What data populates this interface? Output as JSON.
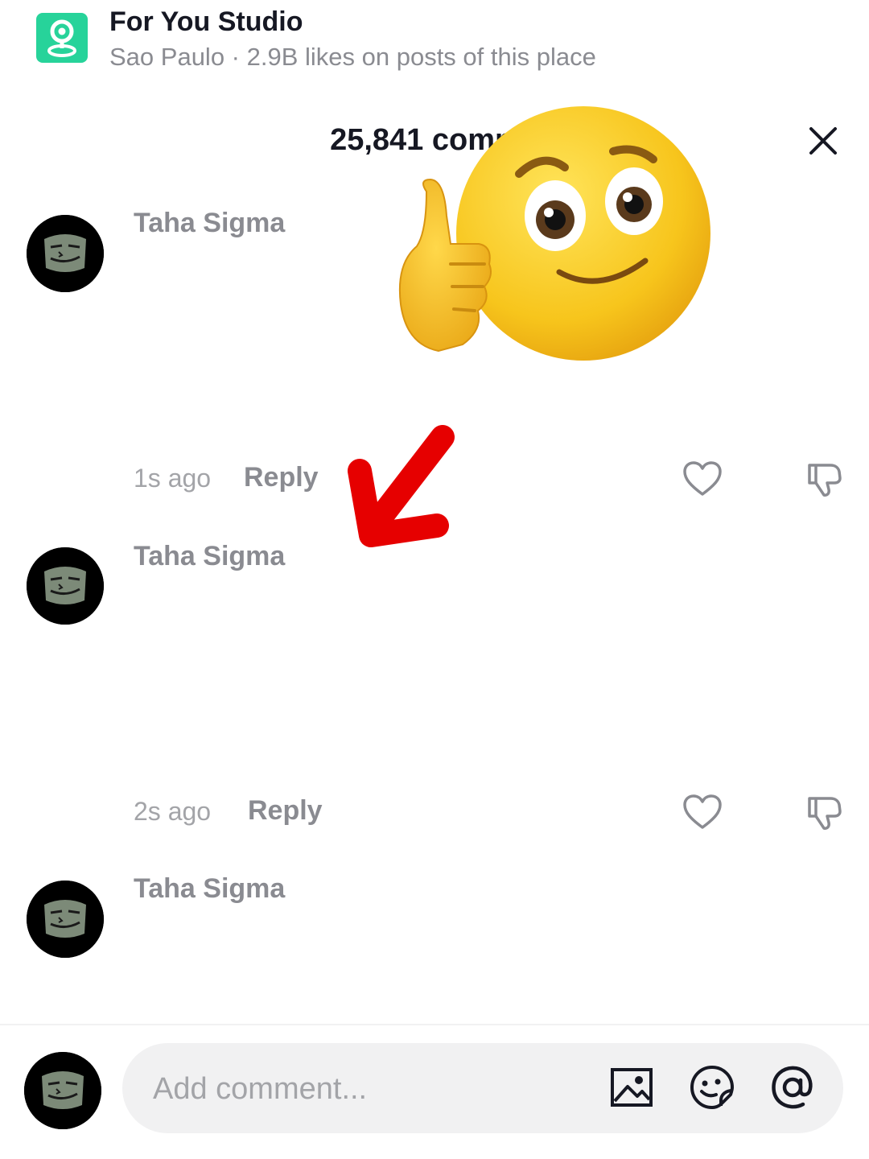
{
  "location": {
    "name": "For You Studio",
    "subtitle": "Sao Paulo · 2.9B likes on posts of this place",
    "accent": "#27d39a"
  },
  "comments_sheet": {
    "count_text": "25,841 comme"
  },
  "comments": [
    {
      "user": "Taha Sigma",
      "time": "1s ago",
      "reply_label": "Reply"
    },
    {
      "user": "Taha Sigma",
      "time": "2s ago",
      "reply_label": "Reply"
    },
    {
      "user": "Taha Sigma"
    }
  ],
  "composer": {
    "placeholder": "Add comment..."
  },
  "icons": {
    "close": "close-icon",
    "like": "heart-outline-icon",
    "dislike": "thumbs-down-icon",
    "image": "image-icon",
    "sticker": "emoji-sticker-icon",
    "mention": "at-mention-icon"
  },
  "overlays": {
    "emoji": "thumbs-up smiling emoji",
    "arrow_color": "#e60000"
  }
}
